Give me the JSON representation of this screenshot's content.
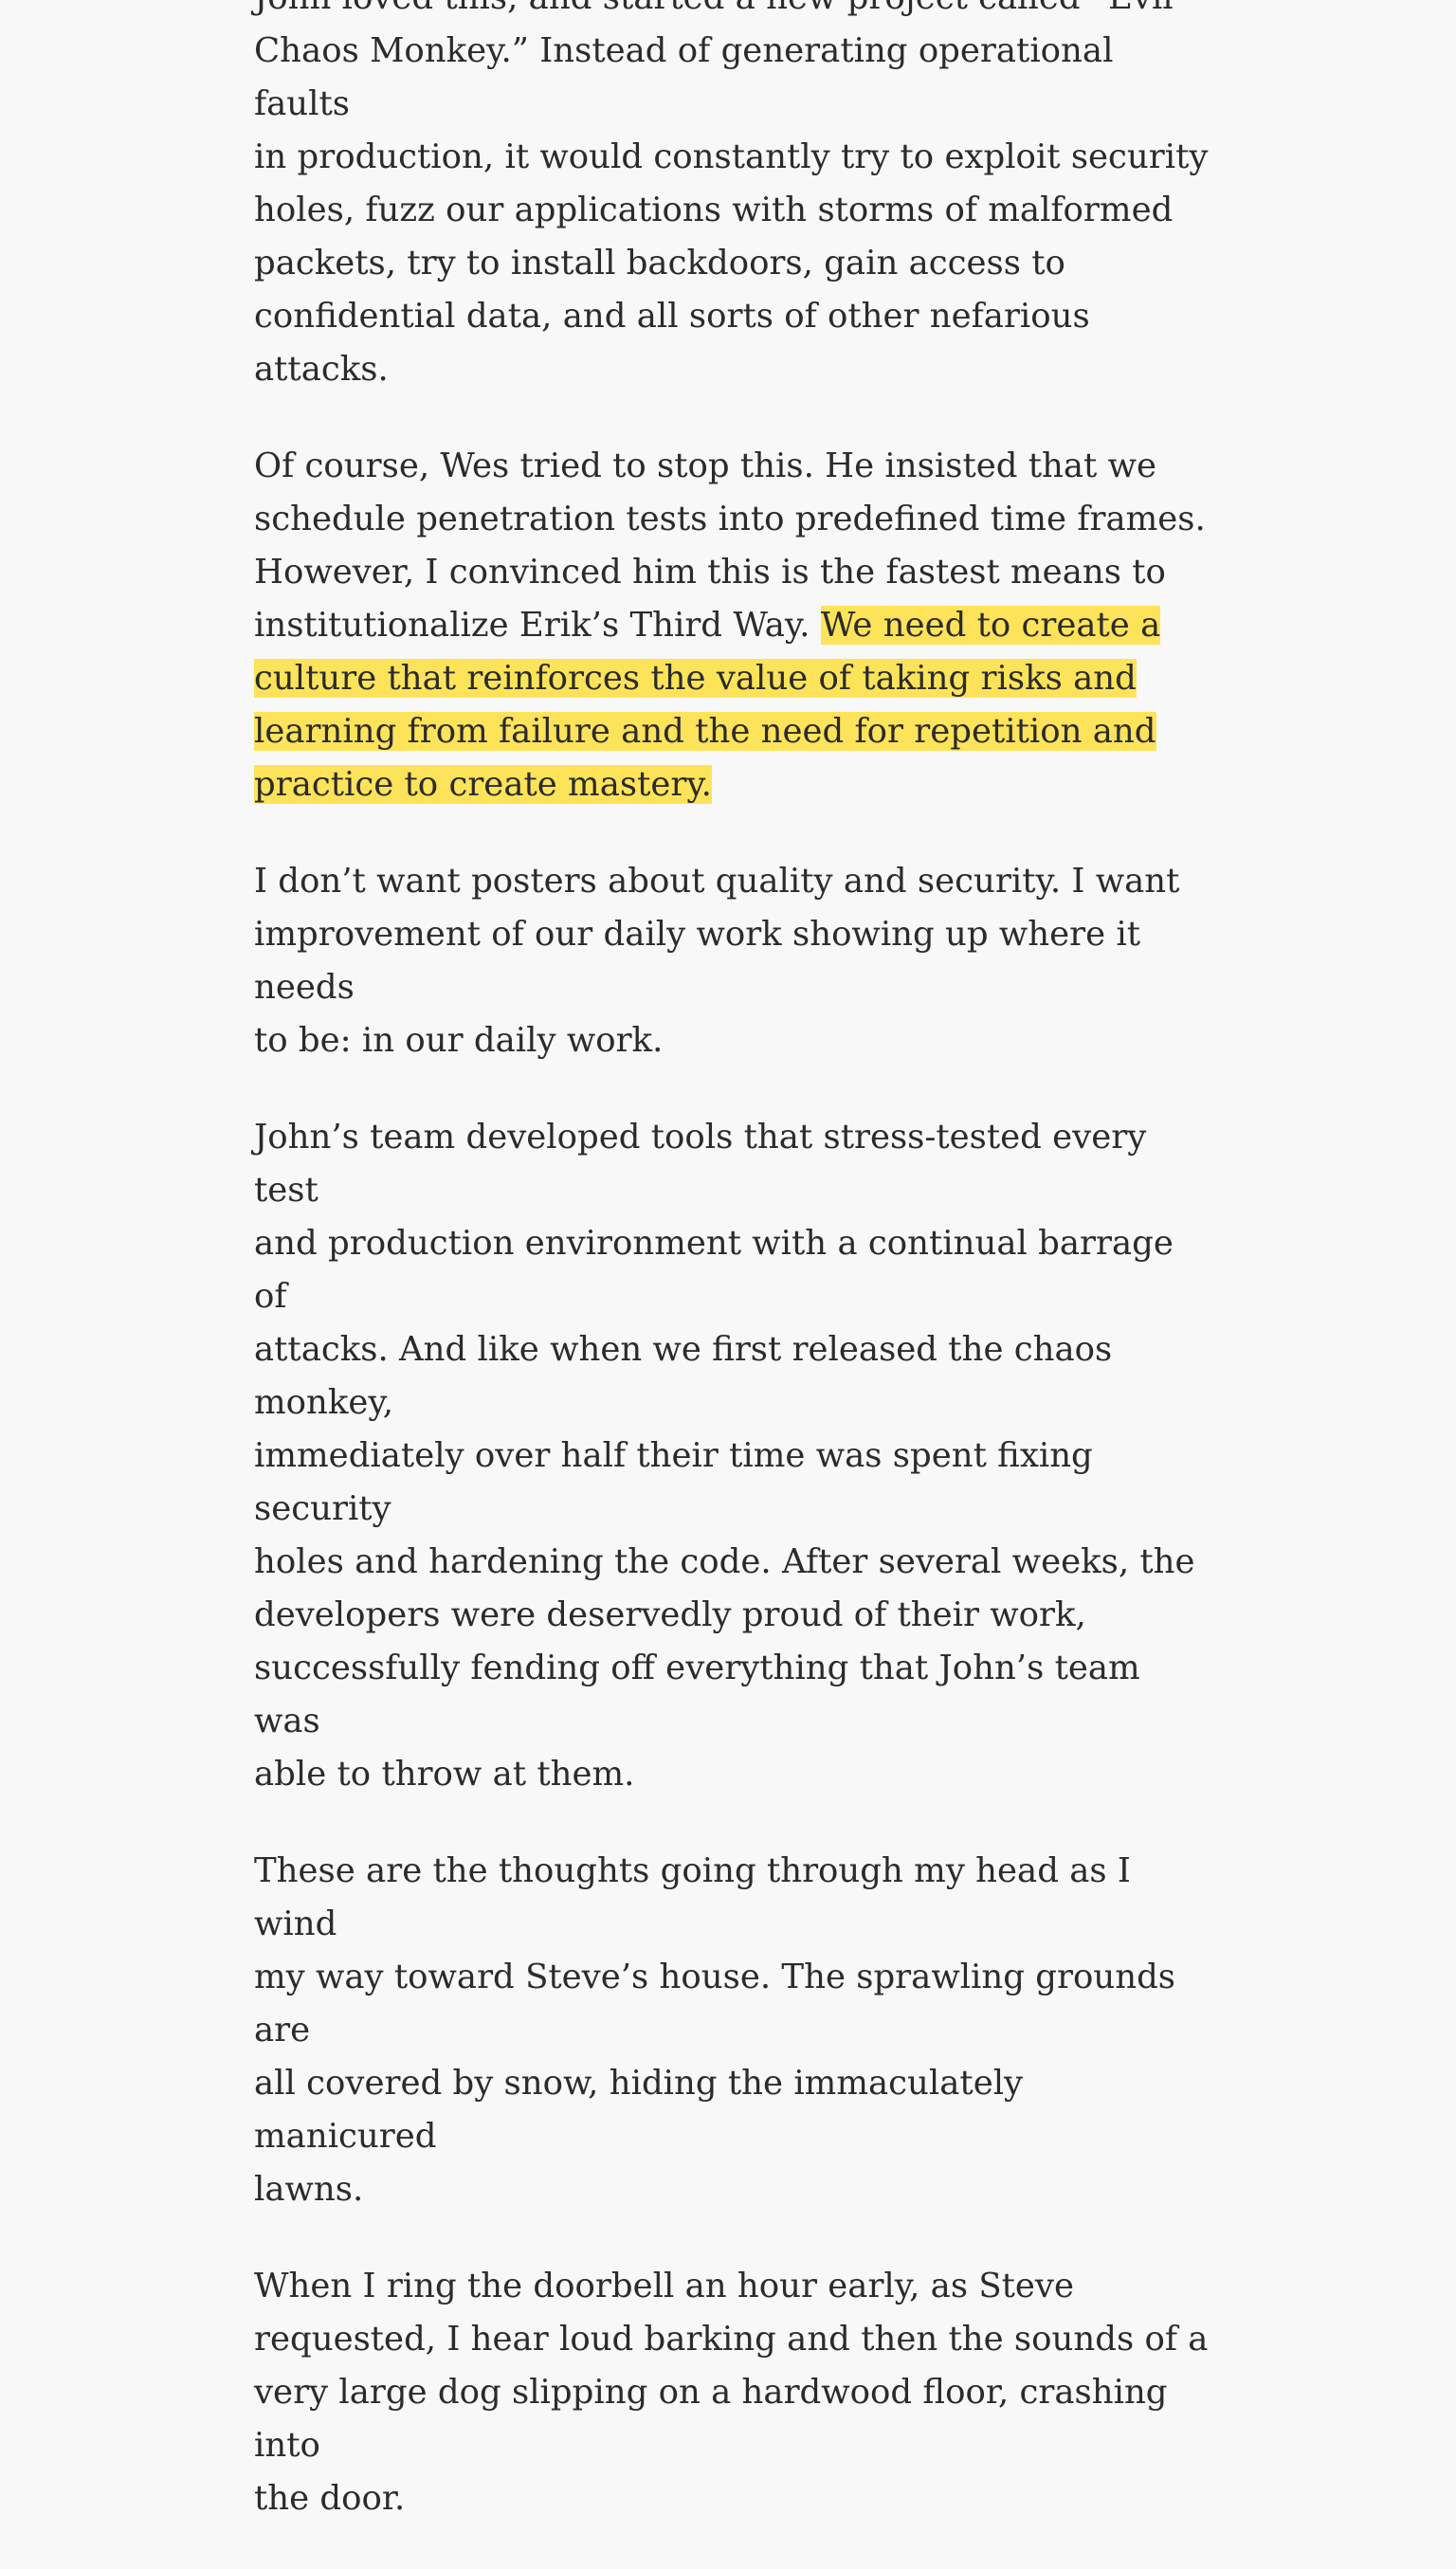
{
  "book": {
    "paragraphs": [
      {
        "lines": [
          "John loved this, and started a new project called “Evil",
          "Chaos Monkey.” Instead of generating operational faults",
          "in production, it would constantly try to exploit security",
          "holes, fuzz our applications with storms of malformed",
          "packets, try to install backdoors, gain access to",
          "confidential data, and all sorts of other nefarious attacks."
        ]
      },
      {
        "lines": [
          "Of course, Wes tried to stop this. He insisted that we",
          "schedule penetration tests into predefined time frames.",
          "However, I convinced him this is the fastest means to",
          "institutionalize Erik’s Third Way."
        ],
        "highlight_lines": [
          "We need to create a",
          "culture that reinforces the value of taking risks and",
          "learning from failure and the need for repetition and",
          "practice to create mastery."
        ]
      },
      {
        "lines": [
          "I don’t want posters about quality and security. I want",
          "improvement of our daily work showing up where it needs",
          "to be: in our daily work."
        ]
      },
      {
        "lines": [
          "John’s team developed tools that stress-tested every test",
          "and production environment with a continual barrage of",
          "attacks. And like when we first released the chaos monkey,",
          "immediately over half their time was spent fixing security",
          "holes and hardening the code. After several weeks, the",
          "developers were deservedly proud of their work,",
          "successfully fending off everything that John’s team was",
          "able to throw at them."
        ]
      },
      {
        "lines": [
          "These are the thoughts going through my head as I wind",
          "my way toward Steve’s house. The sprawling grounds are",
          "all covered by snow, hiding the immaculately manicured",
          "lawns."
        ]
      },
      {
        "lines": [
          "When I ring the doorbell an hour early, as Steve",
          "requested, I hear loud barking and then the sounds of a",
          "very large dog slipping on a hardwood floor, crashing into",
          "the door."
        ]
      }
    ],
    "colors": {
      "background": "#f8f8f8",
      "text": "#2b2b2b",
      "highlight": "#fde35a"
    }
  }
}
